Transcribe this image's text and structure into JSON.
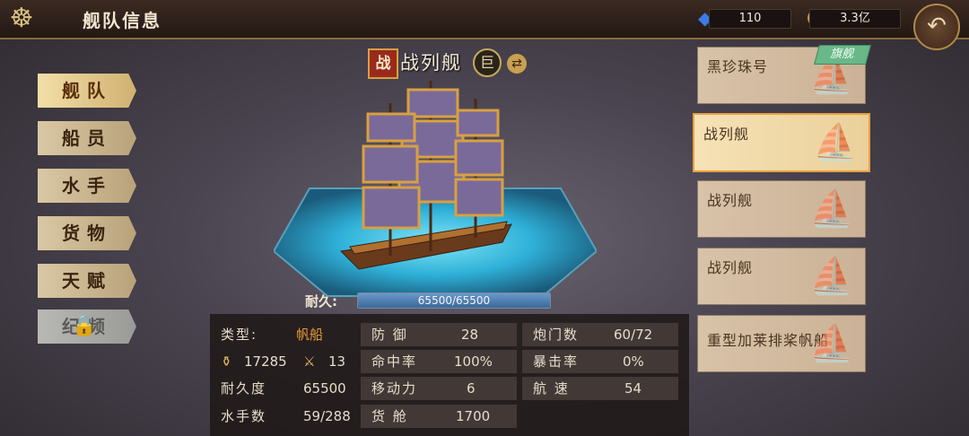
{
  "header": {
    "title": "舰队信息",
    "gems": "110",
    "gold": "3.3亿"
  },
  "menu": {
    "items": [
      {
        "label": "舰队"
      },
      {
        "label": "船员"
      },
      {
        "label": "水手"
      },
      {
        "label": "货物"
      },
      {
        "label": "天赋"
      },
      {
        "label": "纪频"
      }
    ]
  },
  "ship": {
    "class_badge": "战",
    "name": "战列舰",
    "size_badge": "巨",
    "durability_label": "耐久:",
    "durability_text": "65500/65500",
    "durability_fraction": 1.0
  },
  "stats": {
    "type_label": "类型:",
    "type_value": "帆船",
    "cannons_icon_value": "17285",
    "swords_icon_value": "13",
    "durability_label": "耐久度",
    "durability_value": "65500",
    "sailors_label": "水手数",
    "sailors_value": "59/288",
    "defense_label": "防 御",
    "defense_value": "28",
    "accuracy_label": "命中率",
    "accuracy_value": "100%",
    "mobility_label": "移动力",
    "mobility_value": "6",
    "cargo_label": "货 舱",
    "cargo_value": "1700",
    "gunports_label": "炮门数",
    "gunports_value": "60/72",
    "crit_label": "暴击率",
    "crit_value": "0%",
    "speed_label": "航 速",
    "speed_value": "54"
  },
  "fleet": {
    "flagship_badge": "旗舰",
    "items": [
      {
        "name": "黑珍珠号"
      },
      {
        "name": "战列舰"
      },
      {
        "name": "战列舰"
      },
      {
        "name": "战列舰"
      },
      {
        "name": "重型加莱排桨帆船"
      }
    ]
  },
  "colors": {
    "accent_gold": "#d8a040",
    "flag_green": "#6ab88a"
  },
  "icons": [
    "helm-icon",
    "gem-icon",
    "coin-icon",
    "back-arrow-icon",
    "lock-icon",
    "swap-icon",
    "cannon-icon",
    "swords-icon",
    "ship-icon"
  ]
}
